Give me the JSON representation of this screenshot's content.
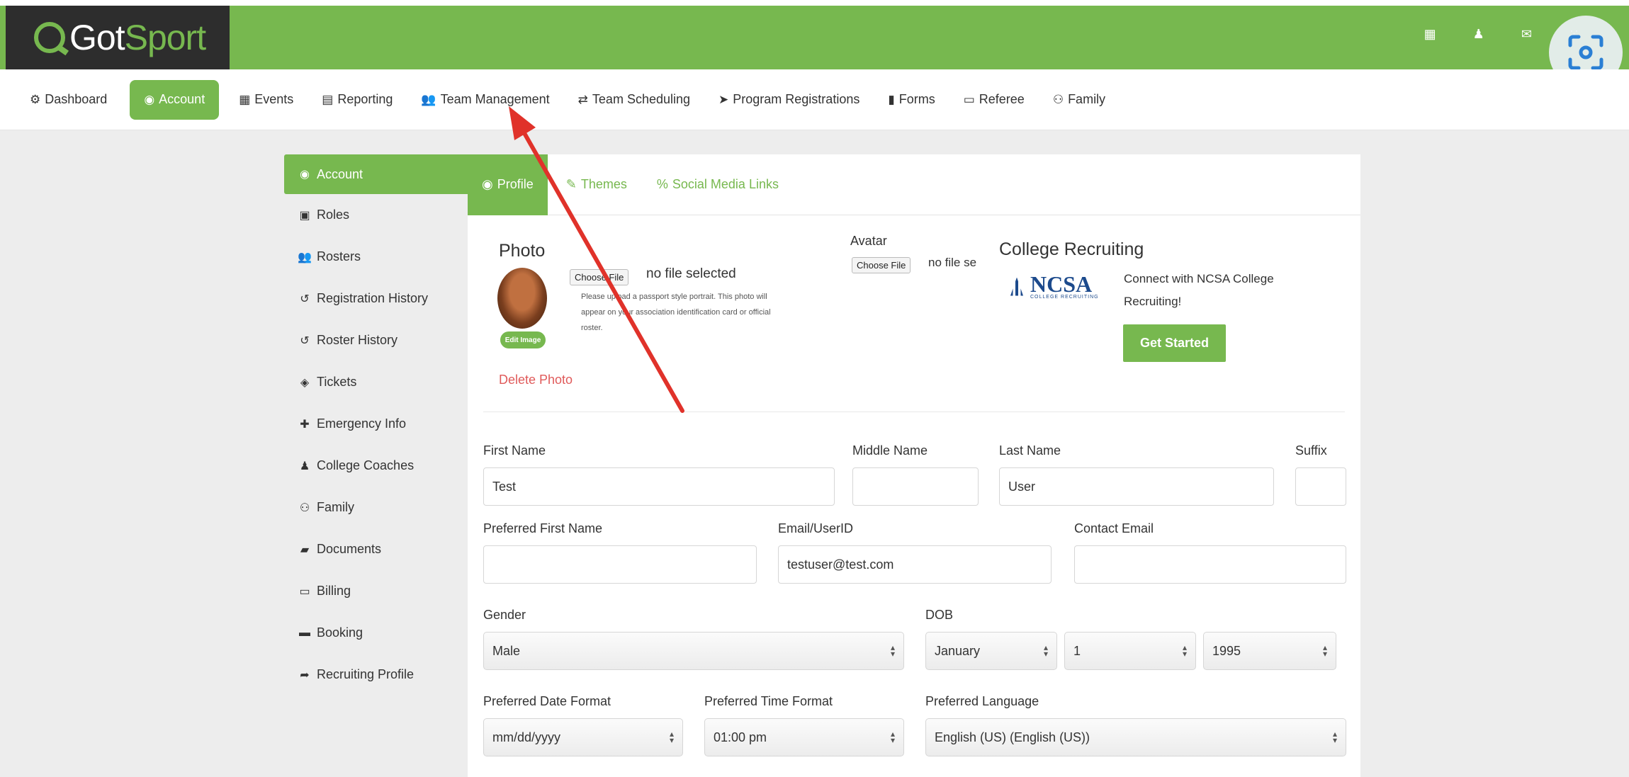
{
  "brand": {
    "name_part1": "Got",
    "name_part2": "Sport"
  },
  "top_icons": [
    "grid-small-icon",
    "user-icon",
    "mail-icon",
    "apps-icon"
  ],
  "nav": {
    "items": [
      {
        "label": "Dashboard",
        "icon": "dashboard-icon",
        "glyph": "⚙"
      },
      {
        "label": "Account",
        "icon": "account-icon",
        "glyph": "◉"
      },
      {
        "label": "Events",
        "icon": "calendar-icon",
        "glyph": "▦"
      },
      {
        "label": "Reporting",
        "icon": "report-icon",
        "glyph": "▤"
      },
      {
        "label": "Team Management",
        "icon": "team-icon",
        "glyph": "👥"
      },
      {
        "label": "Team Scheduling",
        "icon": "exchange-icon",
        "glyph": "⇄"
      },
      {
        "label": "Program Registrations",
        "icon": "send-icon",
        "glyph": "➤"
      },
      {
        "label": "Forms",
        "icon": "file-icon",
        "glyph": "▮"
      },
      {
        "label": "Referee",
        "icon": "calendar-icon",
        "glyph": "▭"
      },
      {
        "label": "Family",
        "icon": "sitemap-icon",
        "glyph": "⚇"
      }
    ],
    "active": "Account"
  },
  "sidebar": {
    "items": [
      {
        "label": "Account",
        "glyph": "◉"
      },
      {
        "label": "Roles",
        "glyph": "▣"
      },
      {
        "label": "Rosters",
        "glyph": "👥"
      },
      {
        "label": "Registration History",
        "glyph": "↺"
      },
      {
        "label": "Roster History",
        "glyph": "↺"
      },
      {
        "label": "Tickets",
        "glyph": "◈"
      },
      {
        "label": "Emergency Info",
        "glyph": "✚"
      },
      {
        "label": "College Coaches",
        "glyph": "♟"
      },
      {
        "label": "Family",
        "glyph": "⚇"
      },
      {
        "label": "Documents",
        "glyph": "▰"
      },
      {
        "label": "Billing",
        "glyph": "▭"
      },
      {
        "label": "Booking",
        "glyph": "▬"
      },
      {
        "label": "Recruiting Profile",
        "glyph": "➦"
      }
    ]
  },
  "tabs": [
    {
      "label": "Profile",
      "glyph": "◉"
    },
    {
      "label": "Themes",
      "glyph": "✎"
    },
    {
      "label": "Social Media Links",
      "glyph": "%"
    }
  ],
  "photo": {
    "label": "Photo",
    "choose_file": "Choose File",
    "no_file": "no file selected",
    "help_text": "Please upload a passport style portrait. This photo will appear on your association identification card or official roster.",
    "edit_image": "Edit Image",
    "delete_photo": "Delete Photo"
  },
  "avatar": {
    "label": "Avatar",
    "choose_file": "Choose File",
    "no_file": "no file se"
  },
  "college_recruiting": {
    "title": "College Recruiting",
    "logo_text": "NCSA",
    "logo_sub": "COLLEGE RECRUITING",
    "text": "Connect with NCSA College Recruiting!",
    "button": "Get Started"
  },
  "form": {
    "first_name": {
      "label": "First Name",
      "value": "Test"
    },
    "middle_name": {
      "label": "Middle Name",
      "value": ""
    },
    "last_name": {
      "label": "Last Name",
      "value": "User"
    },
    "suffix": {
      "label": "Suffix",
      "value": ""
    },
    "preferred_first_name": {
      "label": "Preferred First Name",
      "value": ""
    },
    "email": {
      "label": "Email/UserID",
      "value": "testuser@test.com"
    },
    "contact_email": {
      "label": "Contact Email",
      "value": ""
    },
    "gender": {
      "label": "Gender",
      "value": "Male"
    },
    "dob": {
      "label": "DOB",
      "month": "January",
      "day": "1",
      "year": "1995"
    },
    "date_format": {
      "label": "Preferred Date Format",
      "value": "mm/dd/yyyy"
    },
    "time_format": {
      "label": "Preferred Time Format",
      "value": "01:00 pm"
    },
    "language": {
      "label": "Preferred Language",
      "value": "English (US) (English (US))"
    }
  },
  "colors": {
    "accent": "#77b84f",
    "brand_dark": "#2d2d2d",
    "danger": "#e05a5a",
    "annotation": "#e0322a"
  }
}
